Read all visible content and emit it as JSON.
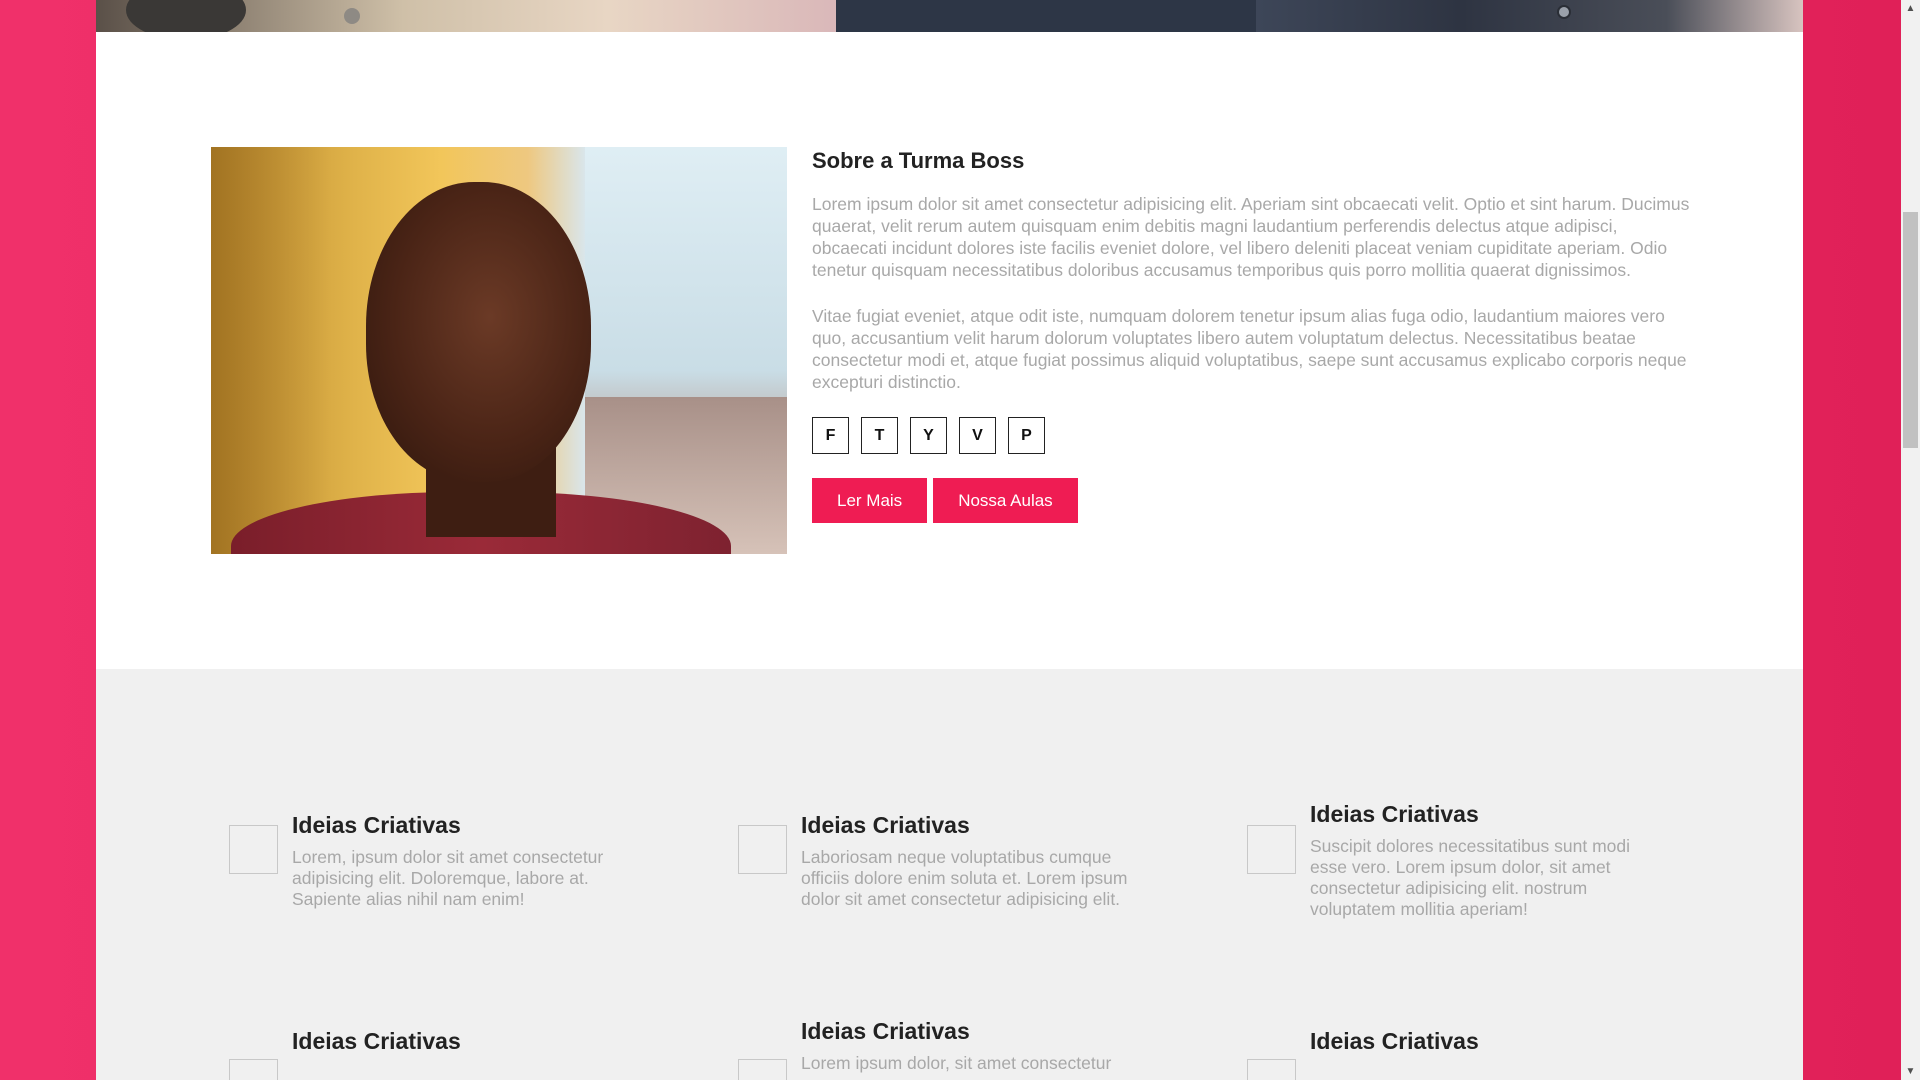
{
  "about": {
    "title": "Sobre a Turma Boss",
    "paragraphs": [
      "Lorem ipsum dolor sit amet consectetur adipisicing elit. Aperiam sint obcaecati velit. Optio et sint harum. Ducimus quaerat, velit rerum autem quisquam enim debitis magni laudantium perferendis delectus atque adipisci, obcaecati incidunt dolores iste facilis eveniet dolore, vel libero deleniti placeat veniam cupiditate aperiam. Odio tenetur quisquam necessitatibus doloribus accusamus temporibus quis porro mollitia quaerat dignissimos.",
      "Vitae fugiat eveniet, atque odit iste, numquam dolorem tenetur ipsum alias fuga odio, laudantium maiores vero quo, accusantium velit harum dolorum voluptates libero autem voluptatum delectus. Necessitatibus beatae consectetur modi et, atque fugiat possimus aliquid voluptatibus, saepe sunt accusamus explicabo corporis neque excepturi distinctio."
    ],
    "social": [
      "F",
      "T",
      "Y",
      "V",
      "P"
    ],
    "buttons": {
      "read_more": "Ler Mais",
      "our_classes": "Nossa Aulas"
    }
  },
  "features": [
    {
      "title": "Ideias Criativas",
      "text": "Lorem, ipsum dolor sit amet consectetur adipisicing elit. Doloremque, labore at. Sapiente alias nihil nam enim!"
    },
    {
      "title": "Ideias Criativas",
      "text": "Laboriosam neque voluptatibus cumque officiis dolore enim soluta et. Lorem ipsum dolor sit amet consectetur adipisicing elit."
    },
    {
      "title": "Ideias Criativas",
      "text": "Suscipit dolores necessitatibus sunt modi esse vero. Lorem ipsum dolor, sit amet consectetur adipisicing elit. nostrum voluptatem mollitia aperiam!"
    },
    {
      "title": "Ideias Criativas",
      "text": ""
    },
    {
      "title": "Ideias Criativas",
      "text": "Lorem ipsum dolor, sit amet consectetur"
    },
    {
      "title": "Ideias Criativas",
      "text": ""
    }
  ],
  "colors": {
    "accent": "#ef1c53",
    "background_gradient_start": "#f0306a",
    "background_gradient_end": "#e02058",
    "features_bg": "#f0f0f0"
  }
}
